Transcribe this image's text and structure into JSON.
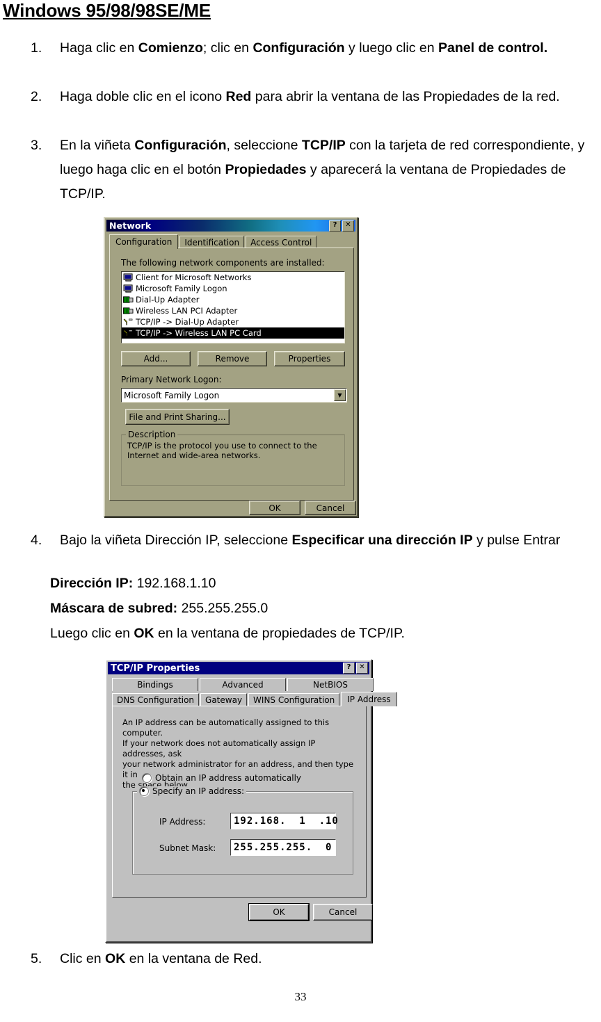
{
  "document": {
    "title": "Windows 95/98/98SE/ME",
    "page_number": "33",
    "steps": [
      {
        "number": "1.",
        "html": "Haga clic en <b>Comienzo</b>; clic en <b>Configuración</b> y luego clic en <b>Panel de control.</b>"
      },
      {
        "number": "2.",
        "html": "Haga doble clic en el icono <b>Red</b> para abrir la ventana de las Propiedades de la red."
      },
      {
        "number": "3.",
        "html": "En la viñeta <b>Configuración</b>, seleccione <b>TCP/IP</b> con la tarjeta de red correspondiente, y luego haga clic en el botón <b>Propiedades</b> y aparecerá la ventana de Propiedades de TCP/IP."
      },
      {
        "number": "4.",
        "html": "Bajo la viñeta Dirección IP, seleccione <b>Especificar una dirección IP</b> y pulse Entrar"
      },
      {
        "number": "5.",
        "html": "Clic en <b>OK</b> en la ventana de Red."
      }
    ],
    "sub_lines": [
      {
        "html": "<b>Dirección IP:</b> 192.168.1.10"
      },
      {
        "html": "<b>Máscara de subred:</b> 255.255.255.0"
      },
      {
        "html": "Luego clic en <b>OK</b> en la ventana de propiedades de TCP/IP."
      }
    ]
  },
  "network_dialog": {
    "title": "Network",
    "help_button": "?",
    "close_button": "✕",
    "tabs": [
      {
        "label": "Configuration",
        "selected": true
      },
      {
        "label": "Identification",
        "selected": false
      },
      {
        "label": "Access Control",
        "selected": false
      }
    ],
    "components_label": "The following network components are installed:",
    "components": [
      {
        "label": "Client for Microsoft Networks",
        "icon": "computer-icon",
        "selected": false
      },
      {
        "label": "Microsoft Family Logon",
        "icon": "computer-icon",
        "selected": false
      },
      {
        "label": "Dial-Up Adapter",
        "icon": "adapter-card-icon",
        "selected": false
      },
      {
        "label": "Wireless LAN PCI Adapter",
        "icon": "adapter-card-icon",
        "selected": false
      },
      {
        "label": "TCP/IP -> Dial-Up Adapter",
        "icon": "protocol-icon",
        "selected": false
      },
      {
        "label": "TCP/IP -> Wireless LAN  PC Card",
        "icon": "protocol-icon",
        "selected": true
      }
    ],
    "buttons": {
      "add": "Add...",
      "remove": "Remove",
      "properties": "Properties"
    },
    "primary_logon_label": "Primary Network Logon:",
    "primary_logon_value": "Microsoft Family Logon",
    "file_print_sharing": "File and Print Sharing...",
    "description_group": "Description",
    "description_text": "TCP/IP is the protocol you use to connect to the Internet and wide-area networks.",
    "ok": "OK",
    "cancel": "Cancel"
  },
  "tcpip_dialog": {
    "title": "TCP/IP Properties",
    "help_button": "?",
    "close_button": "✕",
    "tabs_row1": [
      {
        "label": "Bindings",
        "selected": false
      },
      {
        "label": "Advanced",
        "selected": false
      },
      {
        "label": "NetBIOS",
        "selected": false
      }
    ],
    "tabs_row2": [
      {
        "label": "DNS Configuration",
        "selected": false
      },
      {
        "label": "Gateway",
        "selected": false
      },
      {
        "label": "WINS Configuration",
        "selected": false
      },
      {
        "label": "IP Address",
        "selected": true
      }
    ],
    "info_text_lines": [
      "An IP address can be automatically assigned to this computer.",
      "If your network does not automatically assign IP addresses, ask",
      "your network administrator for an address, and then type it in",
      "the space below."
    ],
    "radio_obtain": "Obtain an IP address automatically",
    "radio_specify": "Specify an IP address:",
    "radio_selected": "specify",
    "ip_address_label": "IP Address:",
    "ip_address_value": "192.168.  1  .10",
    "subnet_mask_label": "Subnet Mask:",
    "subnet_mask_value": "255.255.255.  0",
    "ok": "OK",
    "cancel": "Cancel"
  },
  "colors": {
    "network_dialog_face": "#a3a283",
    "tcpip_dialog_face": "#c0c0c0",
    "titlebar_navy": "#000080",
    "selection_black": "#000000",
    "page_background": "#ffffff"
  }
}
